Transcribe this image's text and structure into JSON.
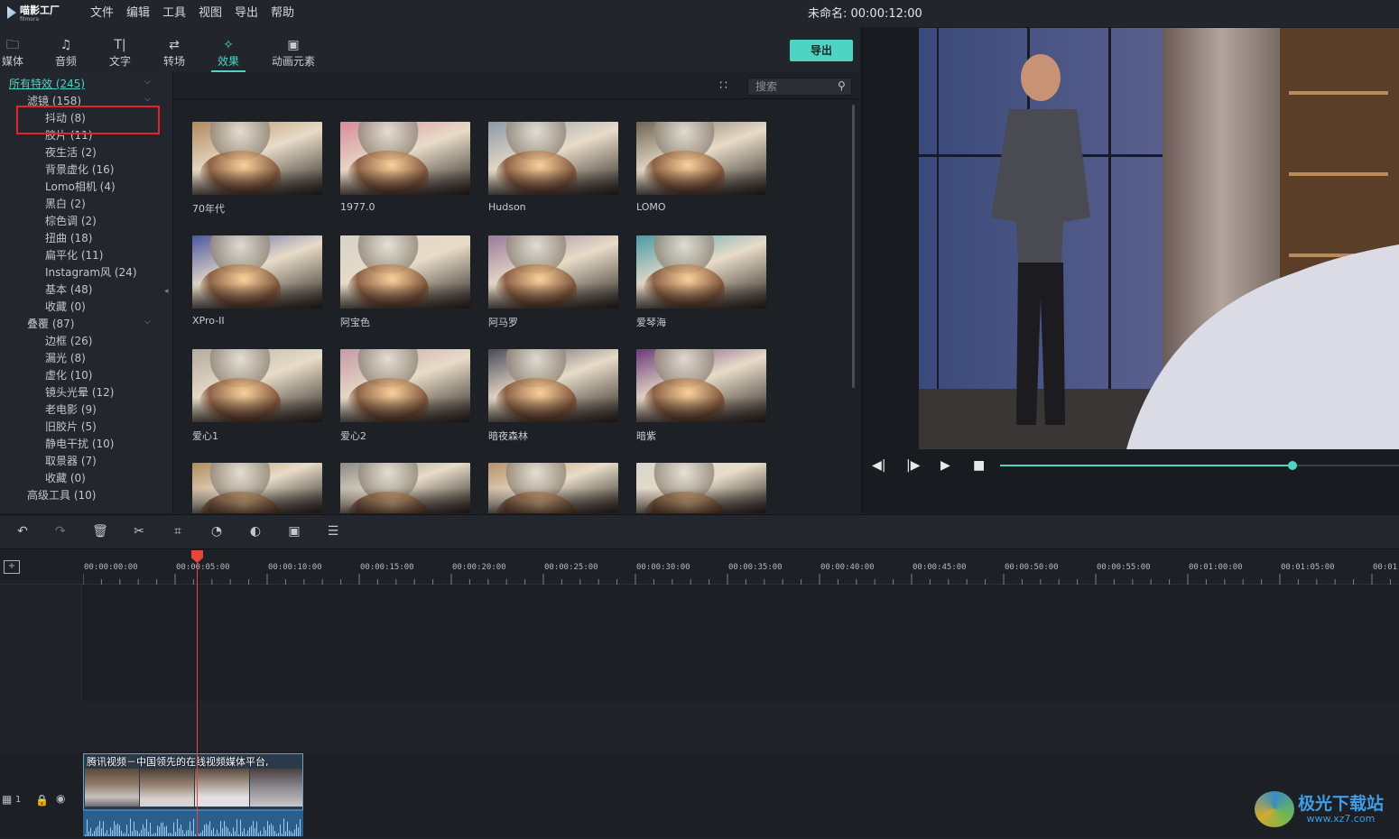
{
  "app": {
    "name": "喵影工厂",
    "sub": "filmora"
  },
  "menu": [
    "文件",
    "编辑",
    "工具",
    "视图",
    "导出",
    "帮助"
  ],
  "project_title": "未命名: 00:00:12:00",
  "tabs": [
    {
      "label": "媒体",
      "icon": "folder-icon"
    },
    {
      "label": "音频",
      "icon": "music-note-icon"
    },
    {
      "label": "文字",
      "icon": "text-icon"
    },
    {
      "label": "转场",
      "icon": "transition-icon"
    },
    {
      "label": "效果",
      "icon": "effects-icon",
      "active": true
    },
    {
      "label": "动画元素",
      "icon": "image-icon"
    }
  ],
  "export_label": "导出",
  "search": {
    "placeholder": "搜索"
  },
  "sidebar": {
    "all": "所有特效 (245)",
    "groups": [
      {
        "label": "滤镜 (158)",
        "items": [
          "抖动 (8)",
          "胶片 (11)",
          "夜生活 (2)",
          "背景虚化 (16)",
          "Lomo相机 (4)",
          "黑白 (2)",
          "棕色调 (2)",
          "扭曲 (18)",
          "扁平化 (11)",
          "Instagram风 (24)",
          "基本 (48)",
          "收藏 (0)"
        ]
      },
      {
        "label": "叠覆 (87)",
        "items": [
          "边框 (26)",
          "漏光 (8)",
          "虚化 (10)",
          "镜头光晕 (12)",
          "老电影 (9)",
          "旧胶片 (5)",
          "静电干扰 (10)",
          "取景器 (7)",
          "收藏 (0)"
        ]
      },
      {
        "label": "高级工具 (10)",
        "items": []
      }
    ]
  },
  "effects": [
    {
      "label": "70年代",
      "tint": "#b08a5c"
    },
    {
      "label": "1977.0",
      "tint": "#d88a9a"
    },
    {
      "label": "Hudson",
      "tint": "#8c9aa8"
    },
    {
      "label": "LOMO",
      "tint": "#6f6454"
    },
    {
      "label": "XPro-II",
      "tint": "#4a56a0"
    },
    {
      "label": "阿宝色",
      "tint": "#d8d2c8"
    },
    {
      "label": "阿马罗",
      "tint": "#9a7a9a"
    },
    {
      "label": "爱琴海",
      "tint": "#4a9aa8"
    },
    {
      "label": "爱心1",
      "tint": "#b5aba0"
    },
    {
      "label": "爱心2",
      "tint": "#c59aa8"
    },
    {
      "label": "暗夜森林",
      "tint": "#4a4a5a"
    },
    {
      "label": "暗紫",
      "tint": "#6a3a7a"
    },
    {
      "label": "",
      "tint": "#b08a5c"
    },
    {
      "label": "",
      "tint": "#8c8a88"
    },
    {
      "label": "",
      "tint": "#b8906a"
    },
    {
      "label": "",
      "tint": "#d8d4cc"
    }
  ],
  "player": {
    "progress": 0.73
  },
  "timeline": {
    "timecodes": [
      "00:00:00:00",
      "00:00:05:00",
      "00:00:10:00",
      "00:00:15:00",
      "00:00:20:00",
      "00:00:25:00",
      "00:00:30:00",
      "00:00:35:00",
      "00:00:40:00",
      "00:00:45:00",
      "00:00:50:00",
      "00:00:55:00",
      "00:01:00:00",
      "00:01:05:00",
      "00:01:"
    ],
    "clip_title": "腾讯视频－中国领先的在线视频媒体平台,",
    "track_number": "1"
  },
  "watermark": {
    "title": "极光下载站",
    "url": "www.xz7.com"
  },
  "colors": {
    "accent": "#4fd4c3",
    "highlight": "#e5232b",
    "playhead": "#e5453b"
  }
}
